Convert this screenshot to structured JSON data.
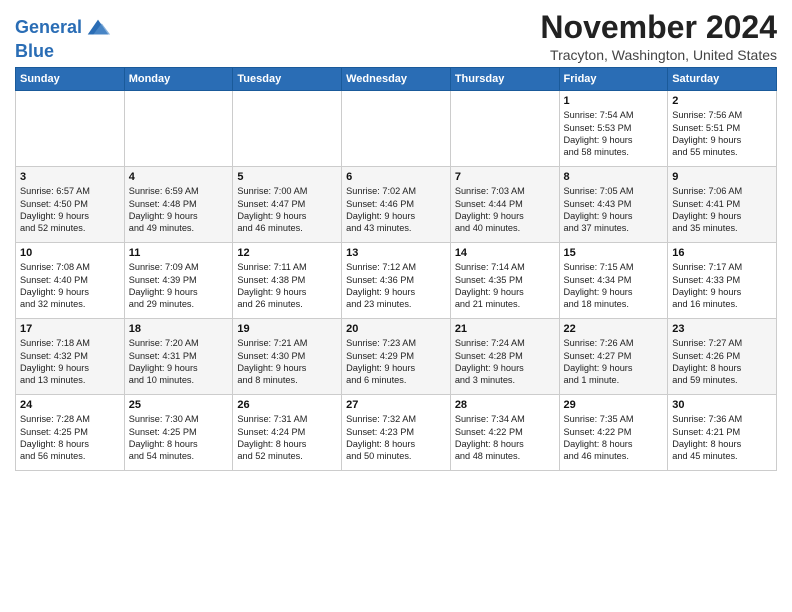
{
  "header": {
    "logo_line1": "General",
    "logo_line2": "Blue",
    "month_title": "November 2024",
    "location": "Tracyton, Washington, United States"
  },
  "days_of_week": [
    "Sunday",
    "Monday",
    "Tuesday",
    "Wednesday",
    "Thursday",
    "Friday",
    "Saturday"
  ],
  "weeks": [
    [
      {
        "day": "",
        "info": ""
      },
      {
        "day": "",
        "info": ""
      },
      {
        "day": "",
        "info": ""
      },
      {
        "day": "",
        "info": ""
      },
      {
        "day": "",
        "info": ""
      },
      {
        "day": "1",
        "info": "Sunrise: 7:54 AM\nSunset: 5:53 PM\nDaylight: 9 hours\nand 58 minutes."
      },
      {
        "day": "2",
        "info": "Sunrise: 7:56 AM\nSunset: 5:51 PM\nDaylight: 9 hours\nand 55 minutes."
      }
    ],
    [
      {
        "day": "3",
        "info": "Sunrise: 6:57 AM\nSunset: 4:50 PM\nDaylight: 9 hours\nand 52 minutes."
      },
      {
        "day": "4",
        "info": "Sunrise: 6:59 AM\nSunset: 4:48 PM\nDaylight: 9 hours\nand 49 minutes."
      },
      {
        "day": "5",
        "info": "Sunrise: 7:00 AM\nSunset: 4:47 PM\nDaylight: 9 hours\nand 46 minutes."
      },
      {
        "day": "6",
        "info": "Sunrise: 7:02 AM\nSunset: 4:46 PM\nDaylight: 9 hours\nand 43 minutes."
      },
      {
        "day": "7",
        "info": "Sunrise: 7:03 AM\nSunset: 4:44 PM\nDaylight: 9 hours\nand 40 minutes."
      },
      {
        "day": "8",
        "info": "Sunrise: 7:05 AM\nSunset: 4:43 PM\nDaylight: 9 hours\nand 37 minutes."
      },
      {
        "day": "9",
        "info": "Sunrise: 7:06 AM\nSunset: 4:41 PM\nDaylight: 9 hours\nand 35 minutes."
      }
    ],
    [
      {
        "day": "10",
        "info": "Sunrise: 7:08 AM\nSunset: 4:40 PM\nDaylight: 9 hours\nand 32 minutes."
      },
      {
        "day": "11",
        "info": "Sunrise: 7:09 AM\nSunset: 4:39 PM\nDaylight: 9 hours\nand 29 minutes."
      },
      {
        "day": "12",
        "info": "Sunrise: 7:11 AM\nSunset: 4:38 PM\nDaylight: 9 hours\nand 26 minutes."
      },
      {
        "day": "13",
        "info": "Sunrise: 7:12 AM\nSunset: 4:36 PM\nDaylight: 9 hours\nand 23 minutes."
      },
      {
        "day": "14",
        "info": "Sunrise: 7:14 AM\nSunset: 4:35 PM\nDaylight: 9 hours\nand 21 minutes."
      },
      {
        "day": "15",
        "info": "Sunrise: 7:15 AM\nSunset: 4:34 PM\nDaylight: 9 hours\nand 18 minutes."
      },
      {
        "day": "16",
        "info": "Sunrise: 7:17 AM\nSunset: 4:33 PM\nDaylight: 9 hours\nand 16 minutes."
      }
    ],
    [
      {
        "day": "17",
        "info": "Sunrise: 7:18 AM\nSunset: 4:32 PM\nDaylight: 9 hours\nand 13 minutes."
      },
      {
        "day": "18",
        "info": "Sunrise: 7:20 AM\nSunset: 4:31 PM\nDaylight: 9 hours\nand 10 minutes."
      },
      {
        "day": "19",
        "info": "Sunrise: 7:21 AM\nSunset: 4:30 PM\nDaylight: 9 hours\nand 8 minutes."
      },
      {
        "day": "20",
        "info": "Sunrise: 7:23 AM\nSunset: 4:29 PM\nDaylight: 9 hours\nand 6 minutes."
      },
      {
        "day": "21",
        "info": "Sunrise: 7:24 AM\nSunset: 4:28 PM\nDaylight: 9 hours\nand 3 minutes."
      },
      {
        "day": "22",
        "info": "Sunrise: 7:26 AM\nSunset: 4:27 PM\nDaylight: 9 hours\nand 1 minute."
      },
      {
        "day": "23",
        "info": "Sunrise: 7:27 AM\nSunset: 4:26 PM\nDaylight: 8 hours\nand 59 minutes."
      }
    ],
    [
      {
        "day": "24",
        "info": "Sunrise: 7:28 AM\nSunset: 4:25 PM\nDaylight: 8 hours\nand 56 minutes."
      },
      {
        "day": "25",
        "info": "Sunrise: 7:30 AM\nSunset: 4:25 PM\nDaylight: 8 hours\nand 54 minutes."
      },
      {
        "day": "26",
        "info": "Sunrise: 7:31 AM\nSunset: 4:24 PM\nDaylight: 8 hours\nand 52 minutes."
      },
      {
        "day": "27",
        "info": "Sunrise: 7:32 AM\nSunset: 4:23 PM\nDaylight: 8 hours\nand 50 minutes."
      },
      {
        "day": "28",
        "info": "Sunrise: 7:34 AM\nSunset: 4:22 PM\nDaylight: 8 hours\nand 48 minutes."
      },
      {
        "day": "29",
        "info": "Sunrise: 7:35 AM\nSunset: 4:22 PM\nDaylight: 8 hours\nand 46 minutes."
      },
      {
        "day": "30",
        "info": "Sunrise: 7:36 AM\nSunset: 4:21 PM\nDaylight: 8 hours\nand 45 minutes."
      }
    ]
  ]
}
